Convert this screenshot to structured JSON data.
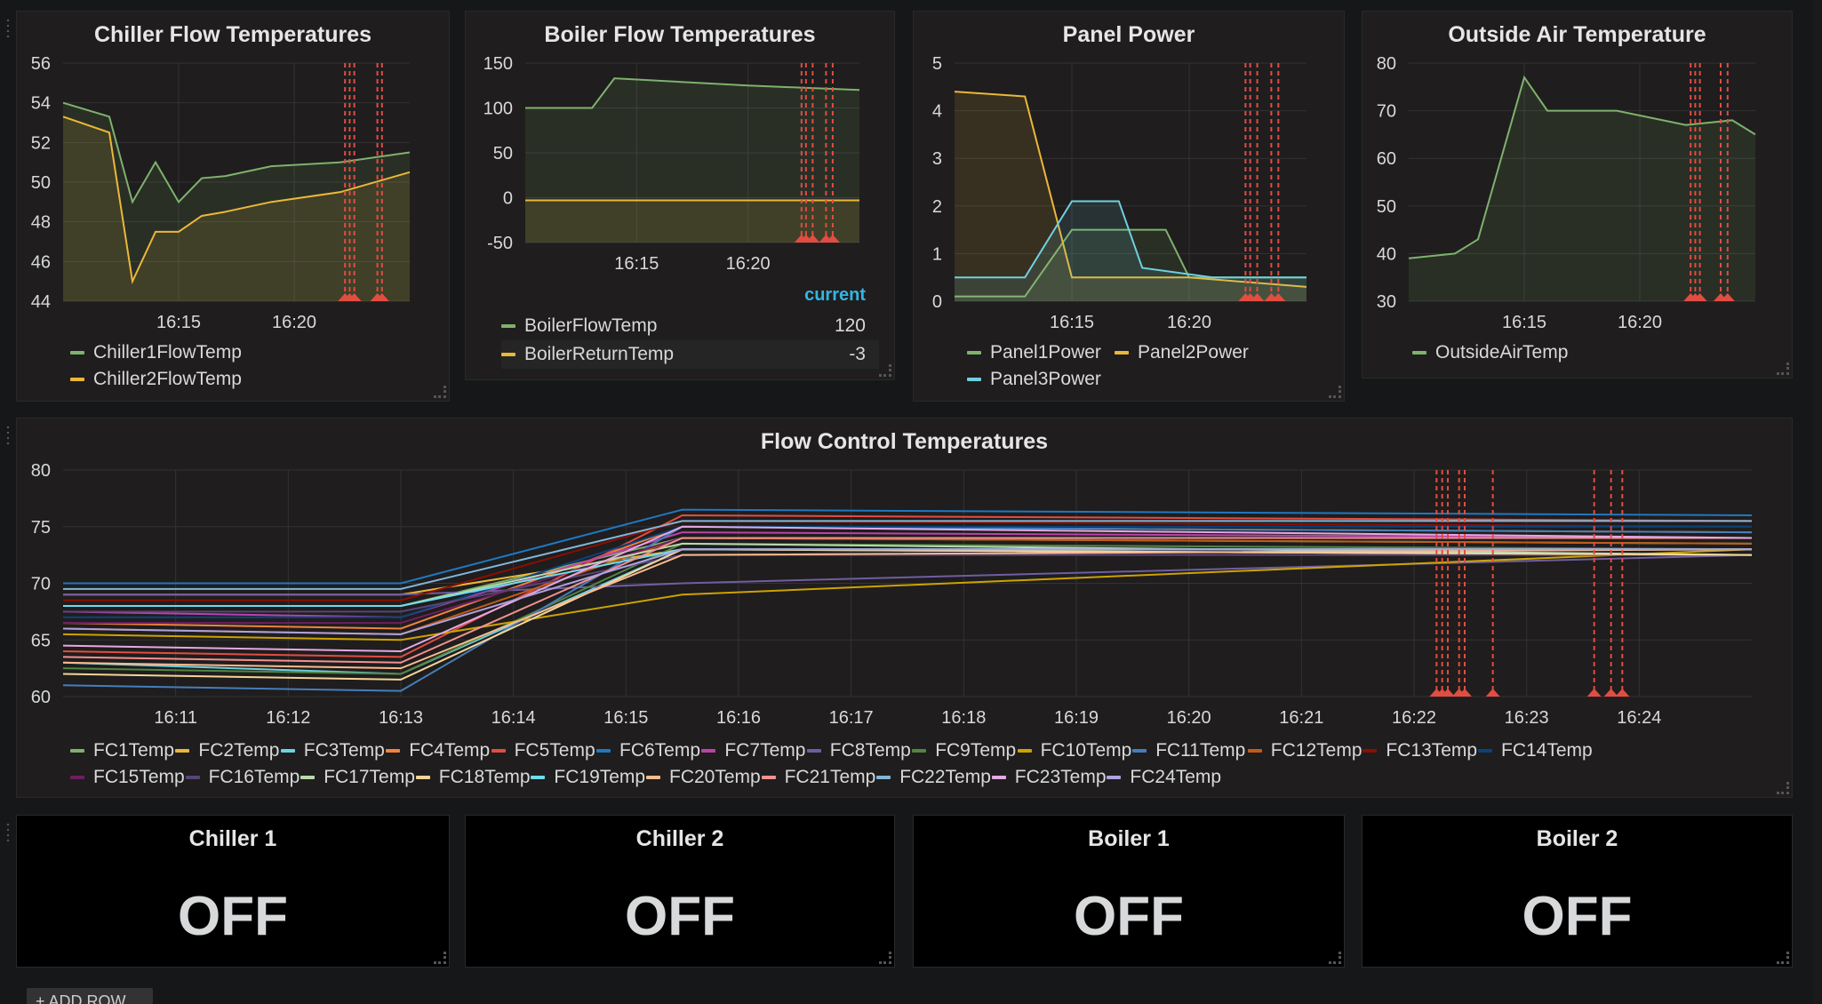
{
  "dashboard": {
    "add_row_label": "+ ADD ROW"
  },
  "panels": {
    "chiller": {
      "title": "Chiller Flow Temperatures",
      "y_ticks": [
        "56",
        "54",
        "52",
        "50",
        "48",
        "46",
        "44"
      ],
      "x_ticks": [
        "16:15",
        "16:20"
      ],
      "legend": [
        "Chiller1FlowTemp",
        "Chiller2FlowTemp"
      ]
    },
    "boiler": {
      "title": "Boiler Flow Temperatures",
      "y_ticks": [
        "150",
        "100",
        "50",
        "0",
        "-50"
      ],
      "x_ticks": [
        "16:15",
        "16:20"
      ],
      "legend_header": "current",
      "legend": [
        {
          "name": "BoilerFlowTemp",
          "current": "120"
        },
        {
          "name": "BoilerReturnTemp",
          "current": "-3"
        }
      ]
    },
    "power": {
      "title": "Panel Power",
      "y_ticks": [
        "5",
        "4",
        "3",
        "2",
        "1",
        "0"
      ],
      "x_ticks": [
        "16:15",
        "16:20"
      ],
      "legend": [
        "Panel1Power",
        "Panel2Power",
        "Panel3Power"
      ]
    },
    "outside": {
      "title": "Outside Air Temperature",
      "y_ticks": [
        "80",
        "70",
        "60",
        "50",
        "40",
        "30"
      ],
      "x_ticks": [
        "16:15",
        "16:20"
      ],
      "legend": [
        "OutsideAirTemp"
      ]
    },
    "flow": {
      "title": "Flow Control Temperatures",
      "y_ticks": [
        "80",
        "75",
        "70",
        "65",
        "60"
      ],
      "x_ticks": [
        "16:11",
        "16:12",
        "16:13",
        "16:14",
        "16:15",
        "16:16",
        "16:17",
        "16:18",
        "16:19",
        "16:20",
        "16:21",
        "16:22",
        "16:23",
        "16:24"
      ],
      "legend": [
        "FC1Temp",
        "FC2Temp",
        "FC3Temp",
        "FC4Temp",
        "FC5Temp",
        "FC6Temp",
        "FC7Temp",
        "FC8Temp",
        "FC9Temp",
        "FC10Temp",
        "FC11Temp",
        "FC12Temp",
        "FC13Temp",
        "FC14Temp",
        "FC15Temp",
        "FC16Temp",
        "FC17Temp",
        "FC18Temp",
        "FC19Temp",
        "FC20Temp",
        "FC21Temp",
        "FC22Temp",
        "FC23Temp",
        "FC24Temp"
      ]
    },
    "stats": [
      {
        "title": "Chiller 1",
        "value": "OFF"
      },
      {
        "title": "Chiller 2",
        "value": "OFF"
      },
      {
        "title": "Boiler 1",
        "value": "OFF"
      },
      {
        "title": "Boiler 2",
        "value": "OFF"
      }
    ]
  },
  "colors": {
    "green": "#7eb26d",
    "yellow": "#eab839",
    "cyan": "#6ed0e0",
    "orange": "#ef843c",
    "red": "#e24d42",
    "blue": "#1f78c1",
    "pink": "#ba43a9",
    "purple": "#705da0",
    "darkgreen": "#508642",
    "gold": "#cca300",
    "steel": "#447ebc",
    "darkorange": "#c15c17",
    "maroon": "#890f02",
    "navy": "#0a437c",
    "plum": "#6d1f62",
    "violet": "#584477",
    "lightgreen": "#b7dbab",
    "lightyellow": "#f4d598",
    "lightcyan": "#70dbed",
    "peach": "#f9ba8f",
    "salmon": "#f29191",
    "lightblue": "#82b5d8",
    "lightpink": "#e5a8e2",
    "lavender": "#aea2e0",
    "annotation": "#e24d42",
    "current": "#33b5e5"
  },
  "chart_data": [
    {
      "type": "line",
      "title": "Chiller Flow Temperatures",
      "ylim": [
        44,
        56
      ],
      "series": [
        {
          "name": "Chiller1FlowTemp",
          "x": [
            "16:10",
            "16:12",
            "16:13",
            "16:14",
            "16:15",
            "16:16",
            "16:17",
            "16:19",
            "16:22",
            "16:25"
          ],
          "values": [
            54,
            53.3,
            49,
            51,
            49,
            50.2,
            50.3,
            50.8,
            51,
            51.5
          ]
        },
        {
          "name": "Chiller2FlowTemp",
          "x": [
            "16:10",
            "16:12",
            "16:13",
            "16:14",
            "16:15",
            "16:16",
            "16:17",
            "16:19",
            "16:22",
            "16:25"
          ],
          "values": [
            53.3,
            52.5,
            45,
            47.5,
            47.5,
            48.3,
            48.5,
            49,
            49.5,
            50.5
          ]
        }
      ]
    },
    {
      "type": "area",
      "title": "Boiler Flow Temperatures",
      "ylim": [
        -50,
        150
      ],
      "series": [
        {
          "name": "BoilerFlowTemp",
          "current": 120,
          "x": [
            "16:10",
            "16:13",
            "16:14",
            "16:20",
            "16:25"
          ],
          "values": [
            100,
            100,
            133,
            125,
            120
          ]
        },
        {
          "name": "BoilerReturnTemp",
          "current": -3,
          "x": [
            "16:10",
            "16:25"
          ],
          "values": [
            -3,
            -3
          ]
        }
      ]
    },
    {
      "type": "line",
      "title": "Panel Power",
      "ylim": [
        0,
        5
      ],
      "series": [
        {
          "name": "Panel1Power",
          "x": [
            "16:10",
            "16:13",
            "16:15",
            "16:19",
            "16:20",
            "16:25"
          ],
          "values": [
            0.1,
            0.1,
            1.5,
            1.5,
            0.5,
            0.5
          ]
        },
        {
          "name": "Panel2Power",
          "x": [
            "16:10",
            "16:13",
            "16:15",
            "16:20",
            "16:25"
          ],
          "values": [
            4.4,
            4.3,
            0.5,
            0.5,
            0.3
          ]
        },
        {
          "name": "Panel3Power",
          "x": [
            "16:10",
            "16:13",
            "16:15",
            "16:17",
            "16:18",
            "16:21",
            "16:25"
          ],
          "values": [
            0.5,
            0.5,
            2.1,
            2.1,
            0.7,
            0.5,
            0.5
          ]
        }
      ]
    },
    {
      "type": "area",
      "title": "Outside Air Temperature",
      "ylim": [
        30,
        80
      ],
      "series": [
        {
          "name": "OutsideAirTemp",
          "x": [
            "16:10",
            "16:12",
            "16:13",
            "16:15",
            "16:16",
            "16:19",
            "16:22",
            "16:24",
            "16:25"
          ],
          "values": [
            39,
            40,
            43,
            77,
            70,
            70,
            67,
            68,
            65
          ]
        }
      ]
    },
    {
      "type": "line",
      "title": "Flow Control Temperatures",
      "ylim": [
        60,
        80
      ],
      "x": [
        "16:10",
        "16:13",
        "16:15.5",
        "16:25"
      ],
      "series_note_only": "",
      "series": [
        {
          "name": "FC1Temp",
          "values": [
            68,
            68,
            74,
            73.5
          ]
        },
        {
          "name": "FC2Temp",
          "values": [
            69,
            69,
            73,
            72.5
          ]
        },
        {
          "name": "FC3Temp",
          "values": [
            63,
            62,
            73,
            73
          ]
        },
        {
          "name": "FC4Temp",
          "values": [
            66.5,
            66,
            75,
            74.5
          ]
        },
        {
          "name": "FC5Temp",
          "values": [
            64,
            63.5,
            76,
            75.5
          ]
        },
        {
          "name": "FC6Temp",
          "values": [
            70,
            70,
            76.5,
            76
          ]
        },
        {
          "name": "FC7Temp",
          "values": [
            67.5,
            67,
            74.5,
            74
          ]
        },
        {
          "name": "FC8Temp",
          "values": [
            69,
            69,
            70,
            72.5
          ]
        },
        {
          "name": "FC9Temp",
          "values": [
            62.5,
            62,
            73.5,
            73
          ]
        },
        {
          "name": "FC10Temp",
          "values": [
            65.5,
            65,
            69,
            73
          ]
        },
        {
          "name": "FC11Temp",
          "values": [
            61,
            60.5,
            75,
            74.5
          ]
        },
        {
          "name": "FC12Temp",
          "values": [
            66,
            65.5,
            74,
            73.5
          ]
        },
        {
          "name": "FC13Temp",
          "values": [
            68.5,
            68.5,
            75.5,
            75
          ]
        },
        {
          "name": "FC14Temp",
          "values": [
            67,
            67,
            75,
            75
          ]
        },
        {
          "name": "FC15Temp",
          "values": [
            66.5,
            66.5,
            74,
            74
          ]
        },
        {
          "name": "FC16Temp",
          "values": [
            67.5,
            67.5,
            72.5,
            72.5
          ]
        },
        {
          "name": "FC17Temp",
          "values": [
            68,
            68,
            73.5,
            72.5
          ]
        },
        {
          "name": "FC18Temp",
          "values": [
            62,
            61.5,
            73,
            72.5
          ]
        },
        {
          "name": "FC19Temp",
          "values": [
            68,
            68,
            73,
            73
          ]
        },
        {
          "name": "FC20Temp",
          "values": [
            63,
            62.5,
            72.5,
            73
          ]
        },
        {
          "name": "FC21Temp",
          "values": [
            63.5,
            63,
            74,
            74
          ]
        },
        {
          "name": "FC22Temp",
          "values": [
            69.5,
            69.5,
            75.5,
            75.5
          ]
        },
        {
          "name": "FC23Temp",
          "values": [
            64.5,
            64,
            75,
            74
          ]
        },
        {
          "name": "FC24Temp",
          "values": [
            66,
            65.5,
            73,
            73
          ]
        }
      ]
    }
  ]
}
